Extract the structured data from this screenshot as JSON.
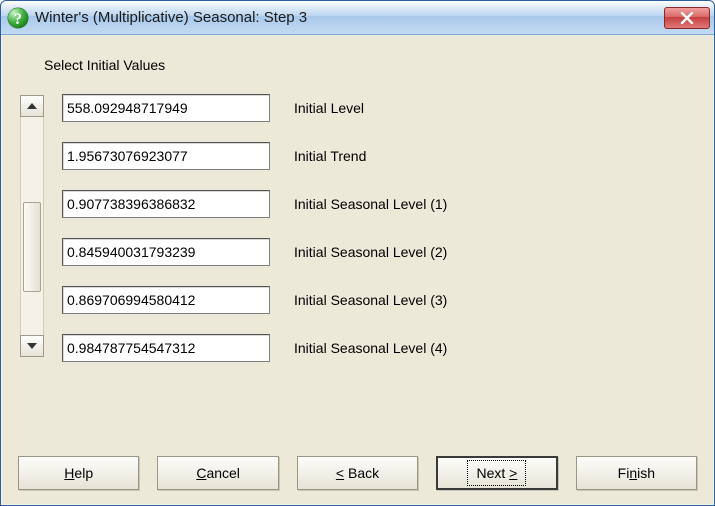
{
  "window": {
    "title": "Winter's (Multiplicative) Seasonal: Step 3"
  },
  "instruction": "Select Initial Values",
  "fields": [
    {
      "value": "558.092948717949",
      "label": "Initial Level"
    },
    {
      "value": "1.95673076923077",
      "label": "Initial Trend"
    },
    {
      "value": "0.907738396386832",
      "label": "Initial Seasonal Level (1)"
    },
    {
      "value": "0.845940031793239",
      "label": "Initial Seasonal Level (2)"
    },
    {
      "value": "0.869706994580412",
      "label": "Initial Seasonal Level (3)"
    },
    {
      "value": "0.984787754547312",
      "label": "Initial Seasonal Level (4)"
    }
  ],
  "buttons": {
    "help_prefix": "H",
    "help_rest": "elp",
    "cancel_prefix": "C",
    "cancel_rest": "ancel",
    "back_lt": "<",
    "back_space": " ",
    "back_prefix": "B",
    "back_rest": "ack",
    "next_prefix": "N",
    "next_rest": "ext ",
    "next_gt": ">",
    "finish_prefix_plain": "Fi",
    "finish_mnem": "n",
    "finish_rest": "ish"
  }
}
